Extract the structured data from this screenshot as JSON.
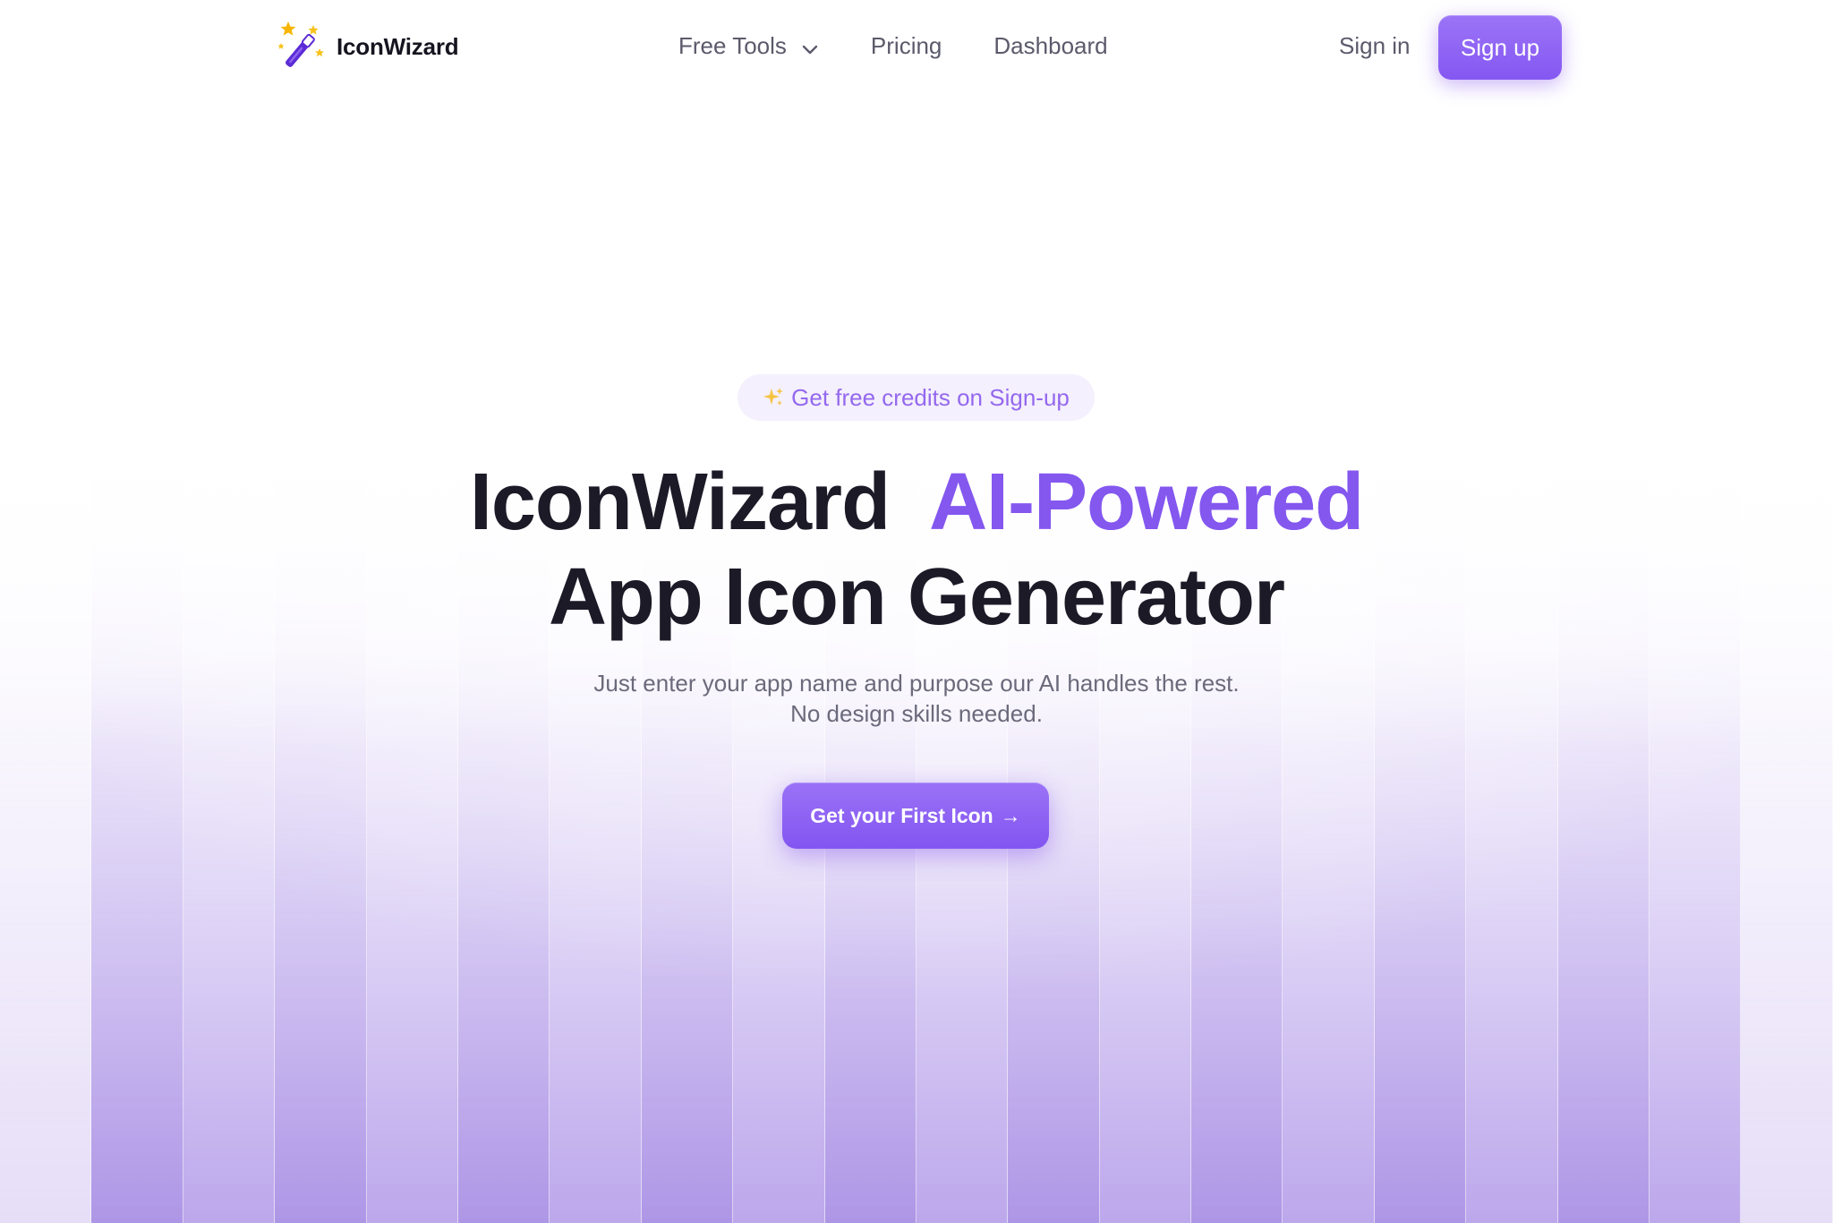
{
  "nav": {
    "brand_name": "IconWizard",
    "brand_icon": "magic-wand-icon",
    "links": [
      {
        "label": "Free Tools",
        "has_dropdown": true,
        "icon": "chevron-down-icon"
      },
      {
        "label": "Pricing"
      },
      {
        "label": "Dashboard"
      }
    ],
    "signin_label": "Sign in",
    "signup_label": "Sign up"
  },
  "hero": {
    "badge_icon": "sparkles-icon",
    "badge_emoji": "✨",
    "badge_text": "Get free credits on Sign-up",
    "headline_part1": "IconWizard",
    "headline_accent": "AI-Powered",
    "headline_line2": "App Icon Generator",
    "subtext_line1": "Just enter your app name and purpose our AI handles the rest.",
    "subtext_line2": "No design skills needed.",
    "cta_label": "Get your First Icon",
    "cta_arrow": "→"
  },
  "colors": {
    "accent": "#8557f2",
    "accent_light": "#9b74f7",
    "badge_bg": "#f4f0fd",
    "badge_text": "#9468ee",
    "heading": "#1c1a27",
    "muted": "#6b6a7b",
    "nav_text": "#5b5a6b",
    "stripe_purple": "#a084e2"
  }
}
